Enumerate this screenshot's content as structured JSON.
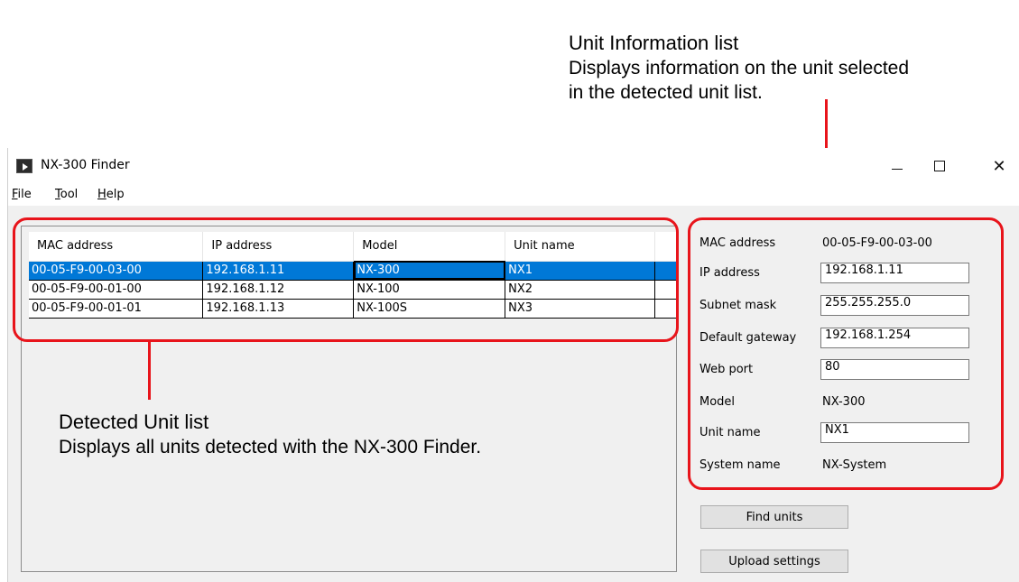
{
  "callouts": {
    "info": {
      "title": "Unit Information list",
      "desc1": "Displays information on the unit selected",
      "desc2": "in the detected unit list."
    },
    "detected": {
      "title": "Detected Unit list",
      "desc": "Displays all units detected with the NX-300 Finder."
    },
    "accent_color": "#e8141b"
  },
  "window": {
    "title": "NX-300 Finder",
    "icon": "app-icon",
    "controls": {
      "minimize": "minimize-icon",
      "maximize": "maximize-icon",
      "close": "✕"
    }
  },
  "menu": [
    {
      "pre": "",
      "u": "F",
      "post": "ile"
    },
    {
      "pre": "",
      "u": "T",
      "post": "ool"
    },
    {
      "pre": "",
      "u": "H",
      "post": "elp"
    }
  ],
  "unit_list": {
    "columns": [
      "MAC address",
      "IP address",
      "Model",
      "Unit name"
    ],
    "rows": [
      {
        "mac": "00-05-F9-00-03-00",
        "ip": "192.168.1.11",
        "model": "NX-300",
        "name": "NX1",
        "selected": true
      },
      {
        "mac": "00-05-F9-00-01-00",
        "ip": "192.168.1.12",
        "model": "NX-100",
        "name": "NX2",
        "selected": false
      },
      {
        "mac": "00-05-F9-00-01-01",
        "ip": "192.168.1.13",
        "model": "NX-100S",
        "name": "NX3",
        "selected": false
      }
    ],
    "selection_color": "#0078d7"
  },
  "unit_info": {
    "mac_label": "MAC address",
    "mac_value": "00-05-F9-00-03-00",
    "ip_label": "IP address",
    "ip_value": "192.168.1.11",
    "subnet_label": "Subnet mask",
    "subnet_value": "255.255.255.0",
    "gateway_label": "Default gateway",
    "gateway_value": "192.168.1.254",
    "webport_label": "Web port",
    "webport_value": "80",
    "model_label": "Model",
    "model_value": "NX-300",
    "unitname_label": "Unit name",
    "unitname_value": "NX1",
    "system_label": "System name",
    "system_value": "NX-System"
  },
  "buttons": {
    "find": "Find units",
    "upload": "Upload settings"
  }
}
